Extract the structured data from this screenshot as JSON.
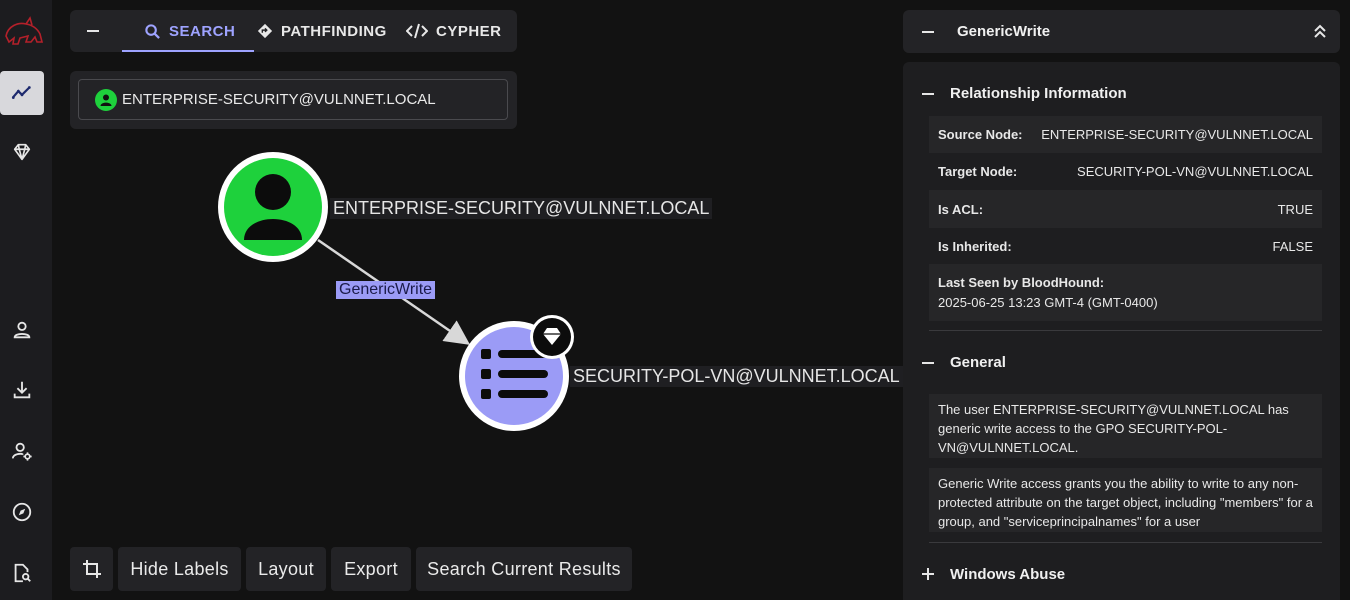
{
  "tabs": [
    {
      "label": "SEARCH",
      "icon": "search-icon"
    },
    {
      "label": "PATHFINDING",
      "icon": "pathfinding-icon"
    },
    {
      "label": "CYPHER",
      "icon": "code-icon"
    }
  ],
  "search": {
    "value": "ENTERPRISE-SECURITY@VULNNET.LOCAL"
  },
  "graph": {
    "source_node": "ENTERPRISE-SECURITY@VULNNET.LOCAL",
    "target_node": "SECURITY-POL-VN@VULNNET.LOCAL",
    "edge": "GenericWrite"
  },
  "toolbar": {
    "hide_labels": "Hide Labels",
    "layout": "Layout",
    "export": "Export",
    "search_current": "Search Current Results"
  },
  "panel": {
    "title": "GenericWrite",
    "relationship": {
      "title": "Relationship Information",
      "rows": [
        {
          "key": "Source Node:",
          "value": "ENTERPRISE-SECURITY@VULNNET.LOCAL"
        },
        {
          "key": "Target Node:",
          "value": "SECURITY-POL-VN@VULNNET.LOCAL"
        },
        {
          "key": "Is ACL:",
          "value": "TRUE"
        },
        {
          "key": "Is Inherited:",
          "value": "FALSE"
        }
      ],
      "last_seen_key": "Last Seen by BloodHound:",
      "last_seen_value": "2025-06-25 13:23 GMT-4 (GMT-0400)"
    },
    "general": {
      "title": "General",
      "text1": "The user ENTERPRISE-SECURITY@VULNNET.LOCAL has generic write access to the GPO SECURITY-POL-VN@VULNNET.LOCAL.",
      "text2": "Generic Write access grants you the ability to write to any non-protected attribute on the target object, including \"members\" for a group, and \"serviceprincipalnames\" for a user"
    },
    "windows_abuse": {
      "title": "Windows Abuse"
    }
  },
  "colors": {
    "accent": "#9ea3ff",
    "user_node": "#1ed13c",
    "gpo_node": "#9b9bf6"
  }
}
